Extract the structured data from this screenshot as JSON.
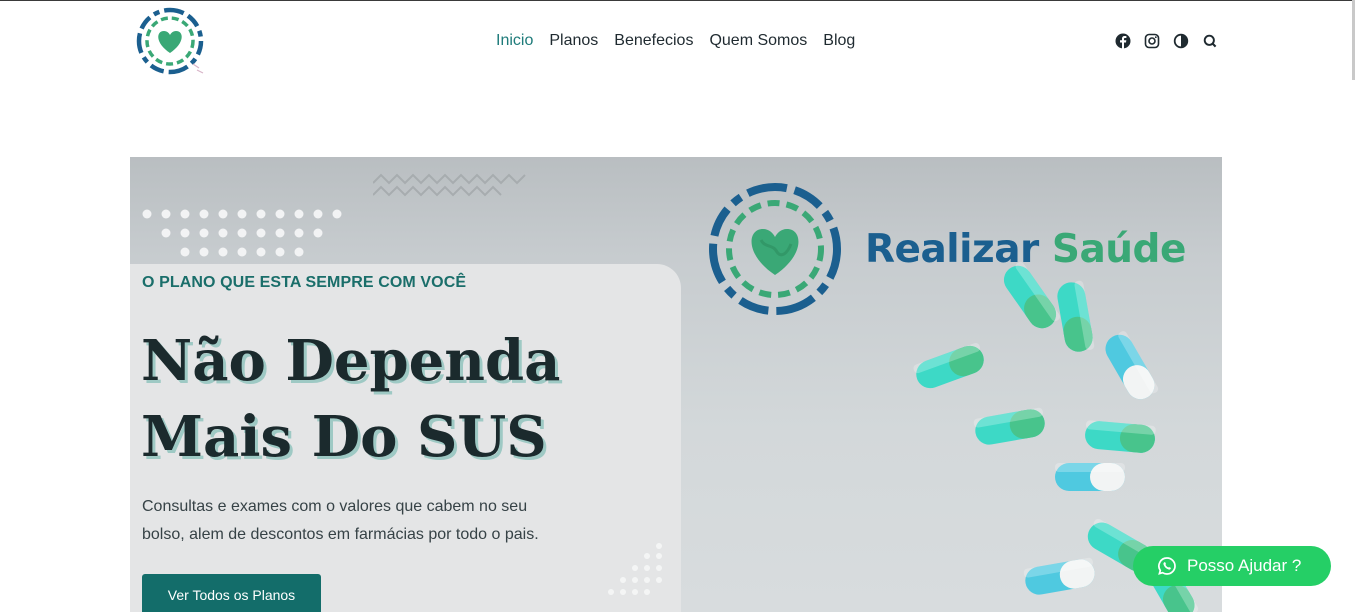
{
  "header": {
    "nav": [
      {
        "label": "Inicio",
        "active": true
      },
      {
        "label": "Planos",
        "active": false
      },
      {
        "label": "Benefecios",
        "active": false
      },
      {
        "label": "Quem Somos",
        "active": false
      },
      {
        "label": "Blog",
        "active": false
      }
    ],
    "social_icons": [
      "facebook-icon",
      "instagram-icon",
      "contrast-toggle-icon",
      "search-icon"
    ]
  },
  "hero": {
    "eyebrow": "O PLANO QUE ESTA SEMPRE COM VOCÊ",
    "headline_line1": "Não Dependa",
    "headline_line2": "Mais Do SUS",
    "subtitle": "Consultas e exames com o valores que cabem no seu bolso, alem de descontos em farmácias por todo o pais.",
    "cta_label": "Ver Todos os Planos",
    "brand_part1": "Realizar",
    "brand_part2": "Saúde"
  },
  "whatsapp": {
    "label": "Posso Ajudar ?"
  },
  "colors": {
    "accent": "#1e7b7a",
    "cta": "#136d6a",
    "brand_blue": "#1b5f8f",
    "brand_green": "#3aa876",
    "whatsapp": "#25cf66"
  }
}
